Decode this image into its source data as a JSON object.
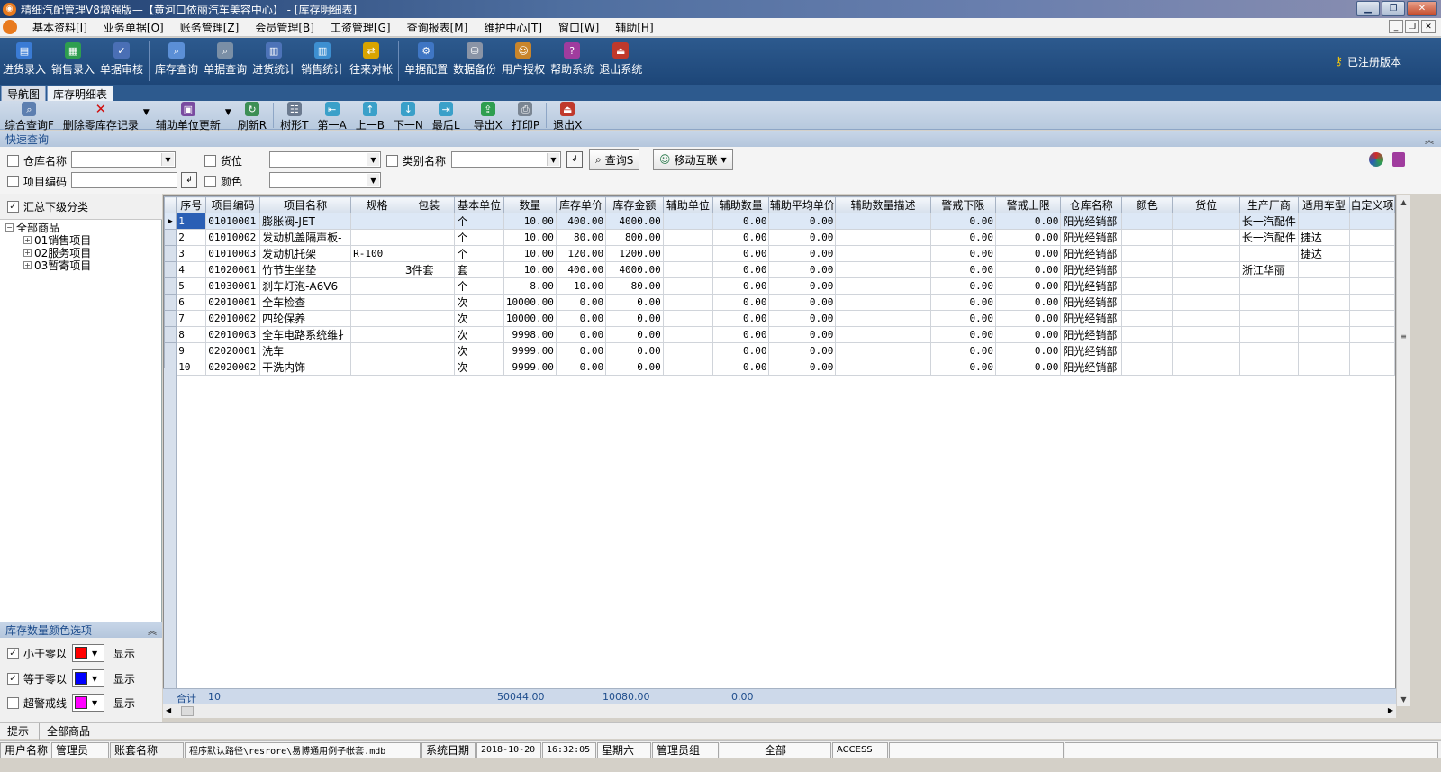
{
  "window": {
    "title": "精细汽配管理V8增强版—【黄河口依丽汽车美容中心】 - [库存明细表]"
  },
  "menu": [
    "基本资料[I]",
    "业务单据[O]",
    "账务管理[Z]",
    "会员管理[B]",
    "工资管理[G]",
    "查询报表[M]",
    "维护中心[T]",
    "窗口[W]",
    "辅助[H]"
  ],
  "toolbar": {
    "group1": [
      {
        "label": "进货录入",
        "icon": "purchase-entry-icon",
        "color": "#3a7bd5"
      },
      {
        "label": "销售录入",
        "icon": "sales-entry-icon",
        "color": "#2e9e4f"
      },
      {
        "label": "单据审核",
        "icon": "document-audit-icon",
        "color": "#4a6fb5"
      }
    ],
    "group2": [
      {
        "label": "库存查询",
        "icon": "inventory-query-icon",
        "color": "#5b8fd6"
      },
      {
        "label": "单据查询",
        "icon": "document-query-icon",
        "color": "#7a8fa6"
      },
      {
        "label": "进货统计",
        "icon": "purchase-stats-icon",
        "color": "#4d73b8"
      },
      {
        "label": "销售统计",
        "icon": "sales-stats-icon",
        "color": "#3d8fd1"
      },
      {
        "label": "往来对帐",
        "icon": "reconciliation-icon",
        "color": "#d9a400"
      }
    ],
    "group3": [
      {
        "label": "单据配置",
        "icon": "document-config-icon",
        "color": "#3f76c4"
      },
      {
        "label": "数据备份",
        "icon": "data-backup-icon",
        "color": "#8a94a6"
      },
      {
        "label": "用户授权",
        "icon": "user-auth-icon",
        "color": "#c9852b"
      },
      {
        "label": "帮助系统",
        "icon": "help-book-icon",
        "color": "#a03c9e"
      },
      {
        "label": "退出系统",
        "icon": "exit-door-icon",
        "color": "#c0392b"
      }
    ],
    "registered": "已注册版本"
  },
  "tabs": [
    "导航图",
    "库存明细表"
  ],
  "subtoolbar": {
    "composite_query": "综合查询F",
    "delete_zero": "删除零库存记录",
    "aux_update": "辅助单位更新",
    "refresh": "刷新R",
    "tree": "树形T",
    "first": "第一A",
    "prev": "上一B",
    "next": "下一N",
    "last": "最后L",
    "export": "导出X",
    "print": "打印P",
    "exit": "退出X"
  },
  "quick_query": {
    "title": "快速查询",
    "warehouse_label": "仓库名称",
    "location_label": "货位",
    "category_label": "类别名称",
    "item_code_label": "项目编码",
    "color_label": "颜色",
    "query_button": "查询S",
    "mobile_button": "移动互联"
  },
  "left": {
    "summary_label": "汇总下级分类",
    "tree_root": "全部商品",
    "tree_children": [
      "01销售项目",
      "02服务项目",
      "03暂寄项目"
    ],
    "color_options_title": "库存数量颜色选项",
    "color_options": [
      {
        "label": "小于零以",
        "checked": true,
        "color": "#ff0000",
        "display": "显示"
      },
      {
        "label": "等于零以",
        "checked": true,
        "color": "#0000ff",
        "display": "显示"
      },
      {
        "label": "超警戒线",
        "checked": false,
        "color": "#ff00ff",
        "display": "显示"
      }
    ]
  },
  "grid": {
    "columns": [
      "序号",
      "项目编码",
      "项目名称",
      "规格",
      "包装",
      "基本单位",
      "数量",
      "库存单价",
      "库存金额",
      "辅助单位",
      "辅助数量",
      "辅助平均单价",
      "辅助数量描述",
      "警戒下限",
      "警戒上限",
      "仓库名称",
      "颜色",
      "货位",
      "生产厂商",
      "适用车型",
      "自定义项"
    ],
    "rows": [
      [
        "1",
        "01010001",
        "膨胀阀-JET",
        "",
        "",
        "个",
        "10.00",
        "400.00",
        "4000.00",
        "",
        "0.00",
        "0.00",
        "",
        "0.00",
        "0.00",
        "阳光经销部",
        "",
        "",
        "长一汽配件",
        "",
        ""
      ],
      [
        "2",
        "01010002",
        "发动机盖隔声板-",
        "",
        "",
        "个",
        "10.00",
        "80.00",
        "800.00",
        "",
        "0.00",
        "0.00",
        "",
        "0.00",
        "0.00",
        "阳光经销部",
        "",
        "",
        "长一汽配件",
        "捷达",
        ""
      ],
      [
        "3",
        "01010003",
        "发动机托架",
        "R-100",
        "",
        "个",
        "10.00",
        "120.00",
        "1200.00",
        "",
        "0.00",
        "0.00",
        "",
        "0.00",
        "0.00",
        "阳光经销部",
        "",
        "",
        "",
        "捷达",
        ""
      ],
      [
        "4",
        "01020001",
        "竹节生坐垫",
        "",
        "3件套",
        "套",
        "10.00",
        "400.00",
        "4000.00",
        "",
        "0.00",
        "0.00",
        "",
        "0.00",
        "0.00",
        "阳光经销部",
        "",
        "",
        "浙江华丽",
        "",
        ""
      ],
      [
        "5",
        "01030001",
        "刹车灯泡-A6V6",
        "",
        "",
        "个",
        "8.00",
        "10.00",
        "80.00",
        "",
        "0.00",
        "0.00",
        "",
        "0.00",
        "0.00",
        "阳光经销部",
        "",
        "",
        "",
        "",
        ""
      ],
      [
        "6",
        "02010001",
        "全车检查",
        "",
        "",
        "次",
        "10000.00",
        "0.00",
        "0.00",
        "",
        "0.00",
        "0.00",
        "",
        "0.00",
        "0.00",
        "阳光经销部",
        "",
        "",
        "",
        "",
        ""
      ],
      [
        "7",
        "02010002",
        "四轮保养",
        "",
        "",
        "次",
        "10000.00",
        "0.00",
        "0.00",
        "",
        "0.00",
        "0.00",
        "",
        "0.00",
        "0.00",
        "阳光经销部",
        "",
        "",
        "",
        "",
        ""
      ],
      [
        "8",
        "02010003",
        "全车电路系统维扌",
        "",
        "",
        "次",
        "9998.00",
        "0.00",
        "0.00",
        "",
        "0.00",
        "0.00",
        "",
        "0.00",
        "0.00",
        "阳光经销部",
        "",
        "",
        "",
        "",
        ""
      ],
      [
        "9",
        "02020001",
        "洗车",
        "",
        "",
        "次",
        "9999.00",
        "0.00",
        "0.00",
        "",
        "0.00",
        "0.00",
        "",
        "0.00",
        "0.00",
        "阳光经销部",
        "",
        "",
        "",
        "",
        ""
      ],
      [
        "10",
        "02020002",
        "干洗内饰",
        "",
        "",
        "次",
        "9999.00",
        "0.00",
        "0.00",
        "",
        "0.00",
        "0.00",
        "",
        "0.00",
        "0.00",
        "阳光经销部",
        "",
        "",
        "",
        "",
        ""
      ]
    ],
    "totals": {
      "label": "合计",
      "count": "10",
      "quantity": "50044.00",
      "amount": "10080.00",
      "aux_qty": "0.00"
    }
  },
  "tipbar": {
    "label": "提示",
    "value": "全部商品"
  },
  "status": {
    "user_label": "用户名称",
    "user": "管理员",
    "account_label": "账套名称",
    "path": "程序默认路径\\resrore\\易博通用例子帐套.mdb",
    "date_label": "系统日期",
    "date": "2018-10-20",
    "time": "16:32:05",
    "weekday": "星期六",
    "group": "管理员组",
    "scope": "全部",
    "db": "ACCESS"
  }
}
